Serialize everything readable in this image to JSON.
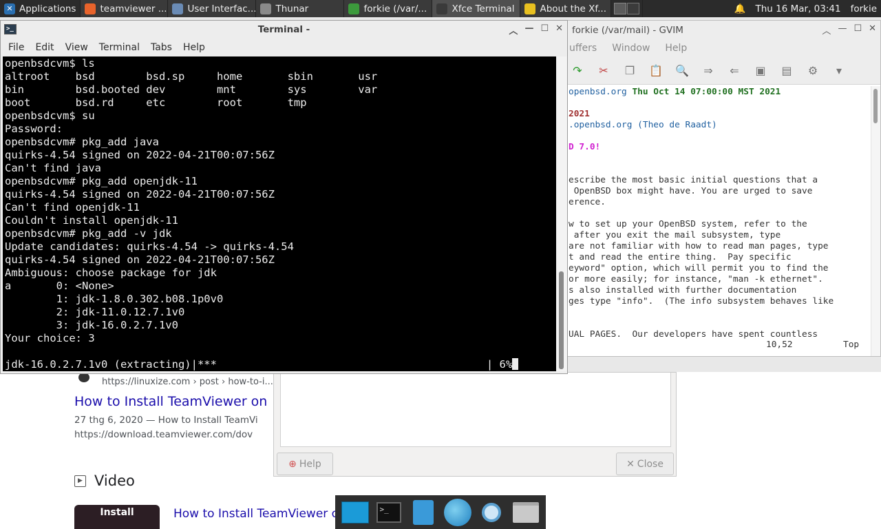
{
  "top_panel": {
    "applications": "Applications",
    "tasks": [
      {
        "label": "teamviewer ...",
        "icon": "firefox-icon",
        "color": "#e8632b"
      },
      {
        "label": "User Interfac...",
        "icon": "window-icon",
        "color": "#6a8bb5"
      },
      {
        "label": "Thunar",
        "icon": "folder-icon",
        "color": "#8a8a8a"
      },
      {
        "label": "forkie (/var/...",
        "icon": "vim-icon",
        "color": "#3c9a3c"
      },
      {
        "label": "Xfce Terminal",
        "icon": "terminal-icon",
        "color": "#3a3a3a"
      },
      {
        "label": "About the Xf...",
        "icon": "star-icon",
        "color": "#e8c020"
      }
    ],
    "clock": "Thu 16 Mar, 03:41",
    "user": "forkie"
  },
  "browser": {
    "result_url": "https://linuxize.com › post › how-to-i...",
    "result_title": "How to Install TeamViewer on",
    "snippet_line1": "27 thg 6, 2020 — How to Install TeamVi",
    "snippet_line2": "https://download.teamviewer.com/dov",
    "video_heading": "Video",
    "video_thumb_label": "Install",
    "video_title": "How to Install TeamViewer on"
  },
  "dialog": {
    "help_label": "Help",
    "close_label": "Close"
  },
  "gvim": {
    "title": "forkie (/var/mail) - GVIM",
    "menu": [
      "uffers",
      "Window",
      "Help"
    ],
    "status_pos": "10,52",
    "status_scroll": "Top",
    "lines": [
      {
        "segs": [
          {
            "t": "openbsd.org ",
            "c": "blue"
          },
          {
            "t": "Thu Oct 14 07:00:00 MST 2021",
            "c": "green"
          }
        ]
      },
      {
        "segs": [
          {
            "t": "",
            "c": ""
          }
        ]
      },
      {
        "segs": [
          {
            "t": "2021",
            "c": "red"
          }
        ]
      },
      {
        "segs": [
          {
            "t": ".openbsd.org ",
            "c": "blue"
          },
          {
            "t": "(Theo de Raadt)",
            "c": "blue"
          }
        ]
      },
      {
        "segs": [
          {
            "t": "",
            "c": ""
          }
        ]
      },
      {
        "segs": [
          {
            "t": "D 7.0!",
            "c": "mag"
          }
        ]
      },
      {
        "segs": [
          {
            "t": "",
            "c": ""
          }
        ]
      },
      {
        "segs": [
          {
            "t": "",
            "c": ""
          }
        ]
      },
      {
        "segs": [
          {
            "t": "escribe the most basic initial questions that a",
            "c": ""
          }
        ]
      },
      {
        "segs": [
          {
            "t": " OpenBSD box might have. ",
            "c": ""
          },
          {
            "t": "You are urged to save",
            "c": ""
          }
        ]
      },
      {
        "segs": [
          {
            "t": "erence.",
            "c": ""
          }
        ]
      },
      {
        "segs": [
          {
            "t": "",
            "c": ""
          }
        ]
      },
      {
        "segs": [
          {
            "t": "w to set up your OpenBSD system, refer to the",
            "c": ""
          }
        ]
      },
      {
        "segs": [
          {
            "t": " after you exit the mail subsystem, type",
            "c": ""
          }
        ]
      },
      {
        "segs": [
          {
            "t": "are not familiar with how to read man pages, type",
            "c": ""
          }
        ]
      },
      {
        "segs": [
          {
            "t": "t and read the entire thing.  Pay specific",
            "c": ""
          }
        ]
      },
      {
        "segs": [
          {
            "t": "eyword\" option, which will permit you to find the",
            "c": ""
          }
        ]
      },
      {
        "segs": [
          {
            "t": "or more easily; for instance, \"man -k ethernet\".",
            "c": ""
          }
        ]
      },
      {
        "segs": [
          {
            "t": "s also installed with further documentation",
            "c": ""
          }
        ]
      },
      {
        "segs": [
          {
            "t": "ges type \"info\".  (The info subsystem behaves like",
            "c": ""
          }
        ]
      },
      {
        "segs": [
          {
            "t": "",
            "c": ""
          }
        ]
      },
      {
        "segs": [
          {
            "t": "",
            "c": ""
          }
        ]
      },
      {
        "segs": [
          {
            "t": "UAL PAGES.  Our developers have spent countless",
            "c": ""
          }
        ]
      }
    ]
  },
  "terminal": {
    "title": "Terminal -",
    "menu": [
      "File",
      "Edit",
      "View",
      "Terminal",
      "Tabs",
      "Help"
    ],
    "lines": [
      "openbsdcvm$ ls",
      "altroot    bsd        bsd.sp     home       sbin       usr",
      "bin        bsd.booted dev        mnt        sys        var",
      "boot       bsd.rd     etc        root       tmp",
      "openbsdcvm$ su",
      "Password:",
      "openbsdcvm# pkg_add java",
      "quirks-4.54 signed on 2022-04-21T00:07:56Z",
      "Can't find java",
      "openbsdcvm# pkg_add openjdk-11",
      "quirks-4.54 signed on 2022-04-21T00:07:56Z",
      "Can't find openjdk-11",
      "Couldn't install openjdk-11",
      "openbsdcvm# pkg_add -v jdk",
      "Update candidates: quirks-4.54 -> quirks-4.54",
      "quirks-4.54 signed on 2022-04-21T00:07:56Z",
      "Ambiguous: choose package for jdk",
      "a       0: <None>",
      "        1: jdk-1.8.0.302.b08.1p0v0",
      "        2: jdk-11.0.12.7.1v0",
      "        3: jdk-16.0.2.7.1v0",
      "Your choice: 3",
      "",
      "jdk-16.0.2.7.1v0 (extracting)|***                                          | 6%"
    ]
  }
}
